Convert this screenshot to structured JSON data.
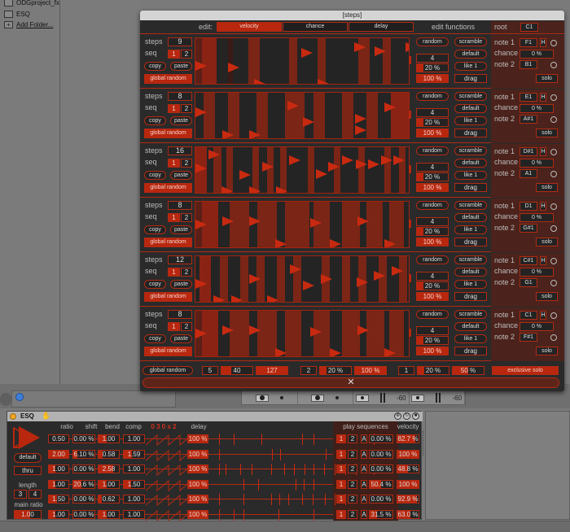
{
  "browser": {
    "items": [
      {
        "label": "ODGproject_fx",
        "icon": "folder-icon"
      },
      {
        "label": "ESQ",
        "icon": "folder-icon"
      },
      {
        "label": "Add Folder...",
        "icon": "add-folder-icon"
      }
    ]
  },
  "window": {
    "title": "[steps]",
    "edit_label": "edit:",
    "edit_tabs": [
      {
        "label": "velocity",
        "active": true
      },
      {
        "label": "chance",
        "active": false
      },
      {
        "label": "delay",
        "active": false
      }
    ],
    "edit_functions_label": "edit functions",
    "root_label": "root",
    "root_value": "C1"
  },
  "track_labels": {
    "steps": "steps",
    "seq": "seq",
    "seq1": "1",
    "seq2": "2",
    "copy": "copy",
    "paste": "paste",
    "global_random": "global random",
    "random": "random",
    "scramble": "scramble",
    "default": "default",
    "like1": "like 1",
    "drag": "drag",
    "note1": "note 1",
    "chance": "chance",
    "note2": "note 2",
    "hold": "H",
    "solo": "solo"
  },
  "tracks": [
    {
      "steps": "9",
      "func_value": "4",
      "pct1": "20 %",
      "pct2": "100 %",
      "note1": "F1",
      "chance": "0 %",
      "note2": "B1"
    },
    {
      "steps": "8",
      "func_value": "4",
      "pct1": "20 %",
      "pct2": "100 %",
      "note1": "E1",
      "chance": "0 %",
      "note2": "A#1"
    },
    {
      "steps": "16",
      "func_value": "4",
      "pct1": "20 %",
      "pct2": "100 %",
      "note1": "D#1",
      "chance": "0 %",
      "note2": "A1"
    },
    {
      "steps": "8",
      "func_value": "4",
      "pct1": "20 %",
      "pct2": "100 %",
      "note1": "D1",
      "chance": "0 %",
      "note2": "G#1"
    },
    {
      "steps": "12",
      "func_value": "4",
      "pct1": "20 %",
      "pct2": "100 %",
      "note1": "C#1",
      "chance": "0 %",
      "note2": "G1"
    },
    {
      "steps": "8",
      "func_value": "4",
      "pct1": "20 %",
      "pct2": "100 %",
      "note1": "C1",
      "chance": "0 %",
      "note2": "F#1"
    }
  ],
  "bottom_bar": {
    "global_random": "global random",
    "values": [
      "5",
      "40",
      "127",
      "2",
      "20 %",
      "100 %",
      "1",
      "20 %",
      "50 %"
    ],
    "exclusive_solo": "exclusive solo",
    "close": "✕"
  },
  "mixer": {
    "values": [
      "-60",
      "-60"
    ]
  },
  "device": {
    "name": "ESQ",
    "columns": {
      "ratio": "ratio",
      "shift": "shift",
      "bend": "bend",
      "comp": "comp",
      "pattern": "0 3 0 x 2",
      "delay": "delay",
      "play_sequences": "play sequences",
      "velocity": "velocity"
    },
    "left": {
      "default": "default",
      "thru": "thru",
      "length_label": "length",
      "length_a": "3",
      "length_b": "4",
      "main_ratio_label": "main ratio",
      "main_ratio": "1.00"
    },
    "rows": [
      {
        "ratio": "0.50",
        "shift": "0.00 %",
        "bend": "1.00",
        "comp": "1.00",
        "delay": "100 %",
        "seq1": "1",
        "seq2": "2",
        "a": "A",
        "pct": "0.00 %",
        "velocity": "82.7 %"
      },
      {
        "ratio": "2.00",
        "shift": "6.10 %",
        "bend": "0.58",
        "comp": "1.59",
        "delay": "100 %",
        "seq1": "1",
        "seq2": "2",
        "a": "A",
        "pct": "0.00 %",
        "velocity": "100 %"
      },
      {
        "ratio": "1.00",
        "shift": "0.00 %",
        "bend": "2.58",
        "comp": "1.00",
        "delay": "100 %",
        "seq1": "1",
        "seq2": "2",
        "a": "A",
        "pct": "0.00 %",
        "velocity": "48.8 %"
      },
      {
        "ratio": "1.00",
        "shift": "20.6 %",
        "bend": "1.00",
        "comp": "1.50",
        "delay": "100 %",
        "seq1": "1",
        "seq2": "2",
        "a": "A",
        "pct": "50.4 %",
        "velocity": "100 %"
      },
      {
        "ratio": "1.50",
        "shift": "0.00 %",
        "bend": "0.62",
        "comp": "1.00",
        "delay": "100 %",
        "seq1": "1",
        "seq2": "2",
        "a": "A",
        "pct": "0.00 %",
        "velocity": "92.9 %"
      },
      {
        "ratio": "1.00",
        "shift": "0.00 %",
        "bend": "1.00",
        "comp": "1.00",
        "delay": "100 %",
        "seq1": "1",
        "seq2": "2",
        "a": "A",
        "pct": "31.5 %",
        "velocity": "63.0 %"
      }
    ]
  },
  "colors": {
    "accent": "#b8270e",
    "panel": "#2a2a2a",
    "note_panel": "#4b231c"
  }
}
